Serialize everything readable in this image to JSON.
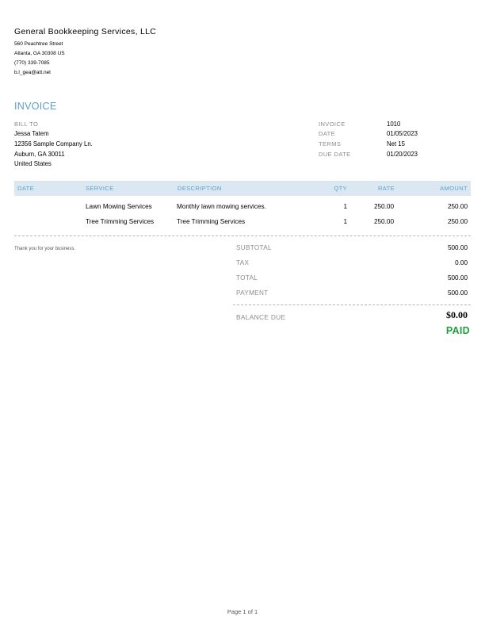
{
  "company": {
    "name": "General Bookkeeping Services, LLC",
    "address_line1": "560 Peachtree Street",
    "address_line2": "Atlanta, GA  30308 US",
    "phone": "(770) 339-7085",
    "email": "b.l_gea@att.net"
  },
  "invoice_title": "INVOICE",
  "bill_to": {
    "label": "BILL TO",
    "name": "Jessa Tatem",
    "company": "12356 Sample Company Ln.",
    "city": "Auburn, GA 30011",
    "country": "United States"
  },
  "meta": {
    "invoice_label": "INVOICE",
    "invoice_value": "1010",
    "date_label": "DATE",
    "date_value": "01/05/2023",
    "terms_label": "TERMS",
    "terms_value": "Net 15",
    "due_date_label": "DUE DATE",
    "due_date_value": "01/20/2023"
  },
  "table": {
    "headers": [
      "DATE",
      "SERVICE",
      "DESCRIPTION",
      "QTY",
      "RATE",
      "AMOUNT"
    ],
    "rows": [
      {
        "date": "",
        "service": "Lawn Mowing Services",
        "description": "Monthly lawn mowing services.",
        "qty": "1",
        "rate": "250.00",
        "amount": "250.00"
      },
      {
        "date": "",
        "service": "Tree Trimming Services",
        "description": "Tree Trimming Services",
        "qty": "1",
        "rate": "250.00",
        "amount": "250.00"
      }
    ]
  },
  "thanks_message": "Thank you for your business.",
  "totals": {
    "subtotal_label": "SUBTOTAL",
    "subtotal_value": "500.00",
    "tax_label": "TAX",
    "tax_value": "0.00",
    "total_label": "TOTAL",
    "total_value": "500.00",
    "payment_label": "PAYMENT",
    "payment_value": "500.00",
    "balance_label": "BALANCE DUE",
    "balance_value": "$0.00",
    "status": "PAID"
  },
  "colors": {
    "accent": "#5ba0c8",
    "table_header_bg": "#dce8f1",
    "paid": "#1e9e3c",
    "label_gray": "#8c8c8c"
  },
  "footer": {
    "page": "Page 1 of 1"
  }
}
